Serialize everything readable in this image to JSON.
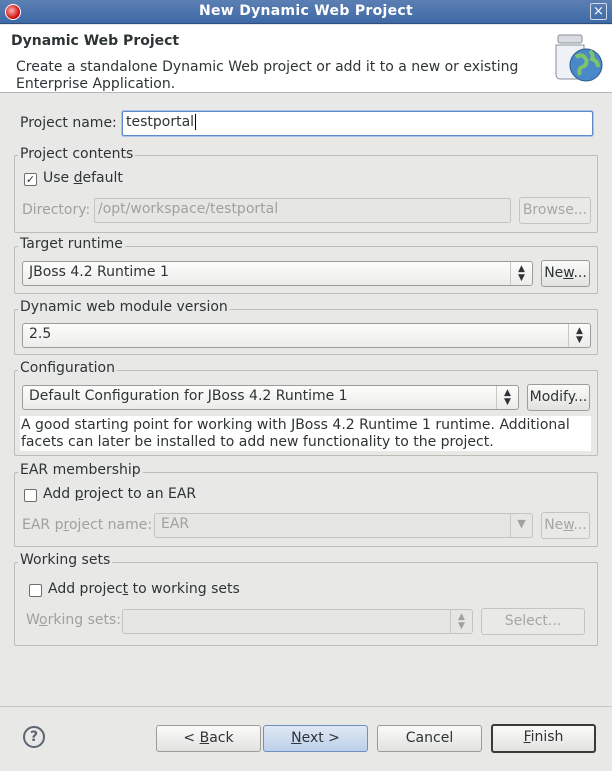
{
  "window": {
    "title": "New Dynamic Web Project",
    "close_glyph": "×"
  },
  "header": {
    "title": "Dynamic Web Project",
    "description": "Create a standalone Dynamic Web project or add it to a new or existing Enterprise Application."
  },
  "project_name": {
    "label": "Project name:",
    "value": "testportal"
  },
  "project_contents": {
    "legend": "Project contents",
    "use_default_pre": "Use ",
    "use_default_u": "d",
    "use_default_post": "efault",
    "use_default_checked": true,
    "check_glyph": "✓",
    "directory_label": "Directory:",
    "directory_value": "/opt/workspace/testportal",
    "browse_label": "Browse..."
  },
  "target_runtime": {
    "legend": "Target runtime",
    "value": "JBoss 4.2 Runtime 1",
    "new_pre": "Ne",
    "new_u": "w",
    "new_post": "..."
  },
  "module_version": {
    "legend": "Dynamic web module version",
    "value": "2.5"
  },
  "configuration": {
    "legend": "Configuration",
    "value": "Default Configuration for JBoss 4.2 Runtime 1",
    "modify_label": "Modify...",
    "description": "A good starting point for working with JBoss 4.2 Runtime 1 runtime. Additional facets can later be installed to add new functionality to the project."
  },
  "ear": {
    "legend": "EAR membership",
    "add_pre": "Add ",
    "add_u": "p",
    "add_post": "roject to an EAR",
    "name_label_pre": "EAR p",
    "name_label_u": "r",
    "name_label_post": "oject name:",
    "name_value": "EAR",
    "new_pre": "Ne",
    "new_u": "w",
    "new_post": "..."
  },
  "working_sets": {
    "legend": "Working sets",
    "add_pre": "Add projec",
    "add_u": "t",
    "add_post": " to working sets",
    "sets_label_pre": "W",
    "sets_label_u": "o",
    "sets_label_post": "rking sets:",
    "select_label": "Select..."
  },
  "footer": {
    "help_glyph": "?",
    "back_pre": "< ",
    "back_u": "B",
    "back_post": "ack",
    "next_u": "N",
    "next_post": "ext >",
    "cancel_label": "Cancel",
    "finish_u": "F",
    "finish_post": "inish"
  },
  "arrows": {
    "updown": "▲▼",
    "down": "▼"
  }
}
